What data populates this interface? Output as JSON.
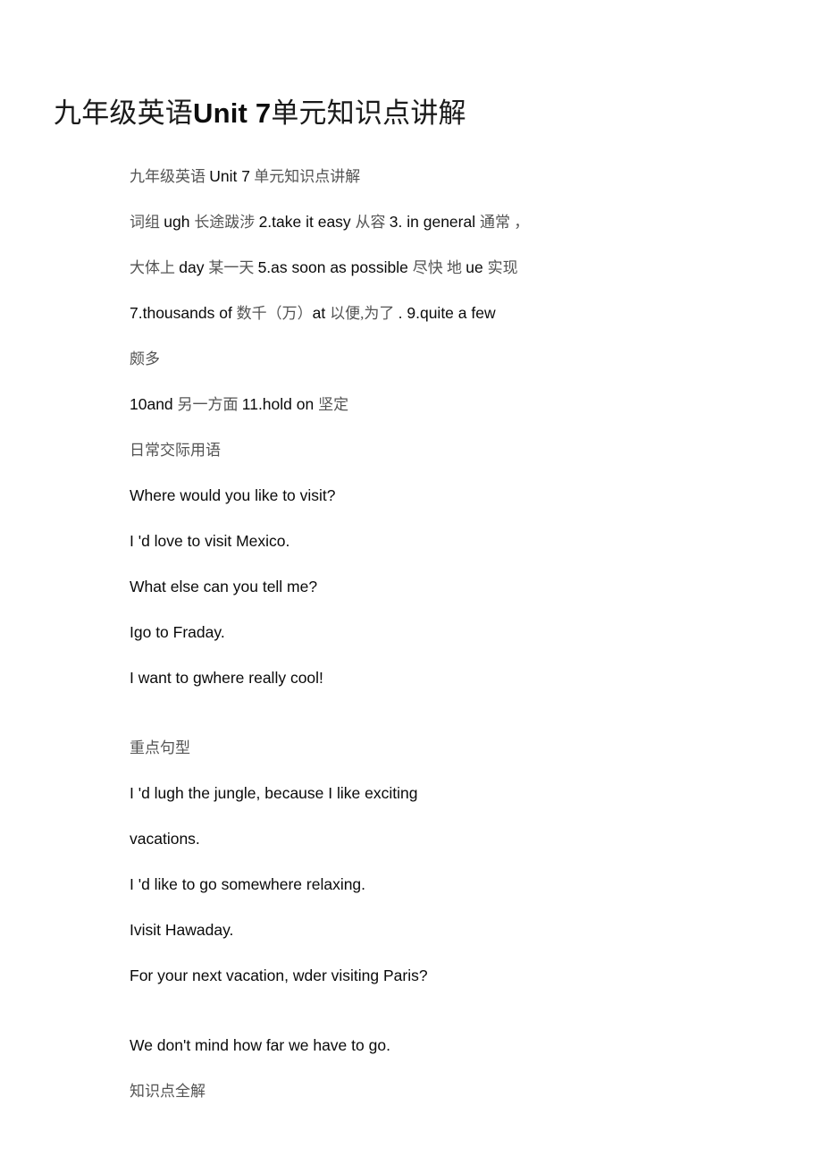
{
  "document": {
    "title_cn_1": "九年级英语",
    "title_en": "Unit 7",
    "title_cn_2": "单元知识点讲解",
    "title_full": "九年级英语 Unit 7 单元知识点讲解",
    "background_color": "#ffffff",
    "text_color": "#0a0a0a",
    "cn_text_color": "#545454"
  },
  "blocks": [
    {
      "name": "subtitle-line",
      "kind": "mixed",
      "runs": [
        {
          "lang": "cn",
          "text": "九年级英语 "
        },
        {
          "lang": "en",
          "text": "Unit 7"
        },
        {
          "lang": "cn",
          "text": " 单元知识点讲解"
        }
      ]
    },
    {
      "name": "phrases-line-1",
      "kind": "mixed",
      "runs": [
        {
          "lang": "cn",
          "text": "词组 "
        },
        {
          "lang": "en",
          "text": "ugh "
        },
        {
          "lang": "cn",
          "text": "长途跋涉 "
        },
        {
          "lang": "en",
          "text": "2.take it easy "
        },
        {
          "lang": "cn",
          "text": "从容 "
        },
        {
          "lang": "en",
          "text": "3. in general "
        },
        {
          "lang": "cn",
          "text": "通常 ，"
        }
      ]
    },
    {
      "name": "phrases-line-2",
      "kind": "mixed",
      "runs": [
        {
          "lang": "cn",
          "text": "大体上 "
        },
        {
          "lang": "en",
          "text": "day "
        },
        {
          "lang": "cn",
          "text": "某一天 "
        },
        {
          "lang": "en",
          "text": "5.as soon as possible "
        },
        {
          "lang": "cn",
          "text": "尽快 地 "
        },
        {
          "lang": "en",
          "text": "ue "
        },
        {
          "lang": "cn",
          "text": "实现"
        }
      ]
    },
    {
      "name": "phrases-line-3",
      "kind": "mixed",
      "runs": [
        {
          "lang": "en",
          "text": "7.thousands of "
        },
        {
          "lang": "cn",
          "text": "数千（万）"
        },
        {
          "lang": "en",
          "text": "at "
        },
        {
          "lang": "cn",
          "text": "以便,为了 "
        },
        {
          "lang": "en",
          "text": ". 9.quite a few"
        }
      ]
    },
    {
      "name": "phrases-line-4",
      "kind": "cn",
      "text": "颇多"
    },
    {
      "name": "phrases-line-5",
      "kind": "mixed",
      "runs": [
        {
          "lang": "en",
          "text": "10and "
        },
        {
          "lang": "cn",
          "text": "另一方面 "
        },
        {
          "lang": "en",
          "text": "11.hold on "
        },
        {
          "lang": "cn",
          "text": "坚定"
        }
      ]
    },
    {
      "name": "heading-daily-expressions",
      "kind": "cn",
      "text": "日常交际用语"
    },
    {
      "name": "dialogue-line-1",
      "kind": "en",
      "text": "Where would you like to visit?"
    },
    {
      "name": "dialogue-line-2",
      "kind": "en",
      "text": "I 'd love to visit Mexico."
    },
    {
      "name": "dialogue-line-3",
      "kind": "en",
      "text": "What else can you tell me?"
    },
    {
      "name": "dialogue-line-4",
      "kind": "en",
      "text": "Igo to Fraday."
    },
    {
      "name": "dialogue-line-5",
      "kind": "en",
      "text": "I want to gwhere really cool!"
    },
    {
      "name": "blank-line-1",
      "kind": "blank",
      "text": ""
    },
    {
      "name": "heading-key-sentence-patterns",
      "kind": "cn",
      "text": "重点句型"
    },
    {
      "name": "pattern-line-1",
      "kind": "en",
      "text": "I 'd lugh the jungle, because I like exciting"
    },
    {
      "name": "pattern-line-2",
      "kind": "en",
      "text": "vacations."
    },
    {
      "name": "pattern-line-3",
      "kind": "en",
      "text": "I 'd like to go somewhere relaxing."
    },
    {
      "name": "pattern-line-4",
      "kind": "en",
      "text": "Ivisit Hawaday."
    },
    {
      "name": "pattern-line-5",
      "kind": "en",
      "text": "For your next vacation, wder visiting Paris?"
    },
    {
      "name": "blank-line-2",
      "kind": "blank",
      "text": ""
    },
    {
      "name": "pattern-line-6",
      "kind": "en",
      "text": "We don't mind how far we have to go."
    },
    {
      "name": "heading-knowledge-points",
      "kind": "cn",
      "text": "知识点全解"
    }
  ]
}
